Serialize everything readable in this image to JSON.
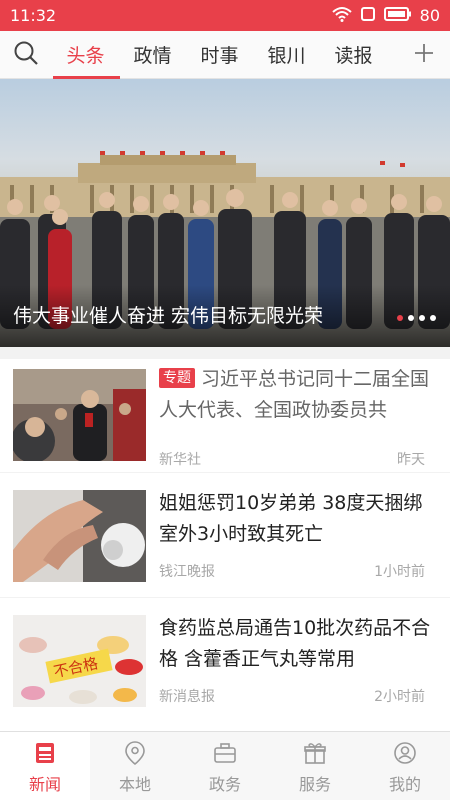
{
  "status_bar": {
    "time": "11:32",
    "battery": "80"
  },
  "tabs": [
    {
      "label": "头条",
      "active": true
    },
    {
      "label": "政情",
      "active": false
    },
    {
      "label": "时事",
      "active": false
    },
    {
      "label": "银川",
      "active": false
    },
    {
      "label": "读报",
      "active": false
    }
  ],
  "hero": {
    "caption": "伟大事业催人奋进 宏伟目标无限光荣",
    "page_dots": 4,
    "active_dot": 1
  },
  "news": [
    {
      "badge": "专题",
      "title": "习近平总书记同十二届全国人大代表、全国政协委员共",
      "source": "新华社",
      "time": "昨天"
    },
    {
      "badge": "",
      "title": "姐姐惩罚10岁弟弟 38度天捆绑室外3小时致其死亡",
      "source": "钱江晚报",
      "time": "1小时前"
    },
    {
      "badge": "",
      "title": "食药监总局通告10批次药品不合格 含藿香正气丸等常用",
      "source": "新消息报",
      "time": "2小时前"
    }
  ],
  "thumb_stamp_text": "不合格",
  "bottom_nav": [
    {
      "label": "新闻",
      "icon": "news-icon",
      "active": true
    },
    {
      "label": "本地",
      "icon": "location-pin-icon",
      "active": false
    },
    {
      "label": "政务",
      "icon": "briefcase-icon",
      "active": false
    },
    {
      "label": "服务",
      "icon": "gift-box-icon",
      "active": false
    },
    {
      "label": "我的",
      "icon": "user-icon",
      "active": false
    }
  ],
  "colors": {
    "accent": "#e8404a",
    "muted_text": "#a8a8a8"
  }
}
